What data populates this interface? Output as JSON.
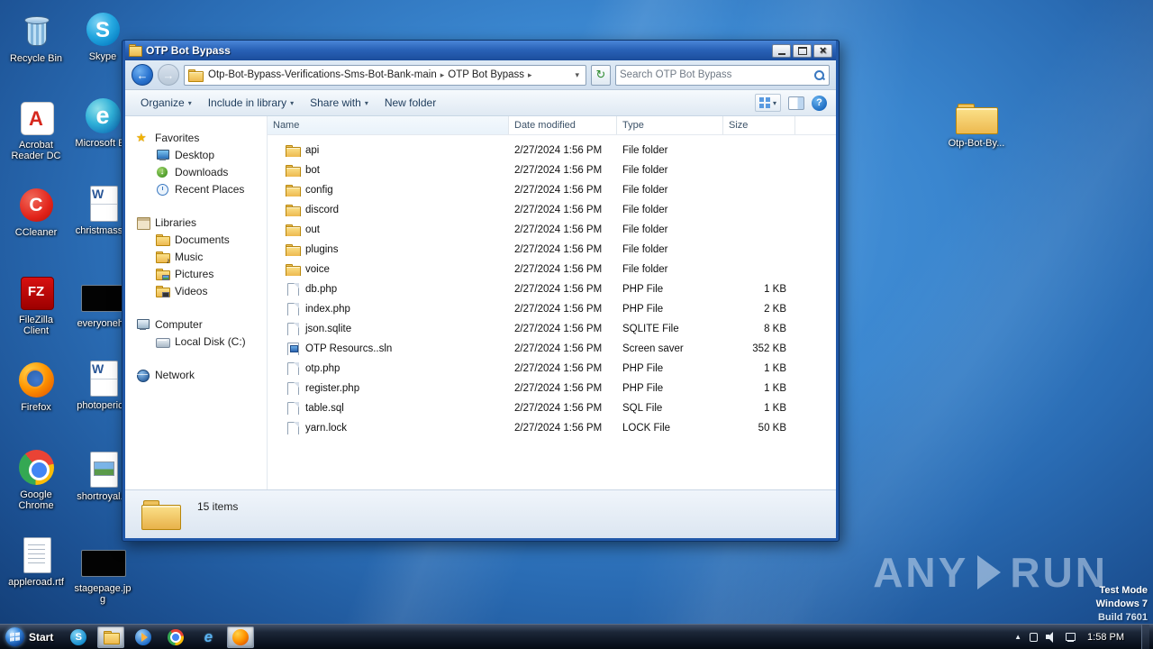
{
  "desktop": {
    "left_icons": [
      {
        "label": "Recycle Bin",
        "kind": "recycle"
      },
      {
        "label": "Skype",
        "kind": "skype"
      },
      {
        "label": "Acrobat Reader DC",
        "kind": "acrobat"
      },
      {
        "label": "Microsoft Ed",
        "kind": "edge"
      },
      {
        "label": "CCleaner",
        "kind": "ccleaner"
      },
      {
        "label": "christmassci",
        "kind": "worddoc"
      },
      {
        "label": "FileZilla Client",
        "kind": "filezilla"
      },
      {
        "label": "everyonehc",
        "kind": "blackimg"
      },
      {
        "label": "Firefox",
        "kind": "firefox"
      },
      {
        "label": "photoperioc",
        "kind": "worddoc"
      },
      {
        "label": "Google Chrome",
        "kind": "chrome"
      },
      {
        "label": "shortroyal.p",
        "kind": "imgfile"
      },
      {
        "label": "appleroad.rtf",
        "kind": "rtf"
      },
      {
        "label": "stagepage.jpg",
        "kind": "blackimg"
      }
    ],
    "right_icon": {
      "label": "Otp-Bot-By...",
      "kind": "folder"
    }
  },
  "window": {
    "title": "OTP Bot Bypass",
    "address": {
      "crumb1": "Otp-Bot-Bypass-Verifications-Sms-Bot-Bank-main",
      "crumb2": "OTP Bot Bypass"
    },
    "search_placeholder": "Search OTP Bot Bypass",
    "toolbar": {
      "organize": "Organize",
      "include": "Include in library",
      "share": "Share with",
      "newfolder": "New folder"
    },
    "sidebar": {
      "favorites": "Favorites",
      "fav_items": [
        "Desktop",
        "Downloads",
        "Recent Places"
      ],
      "libraries": "Libraries",
      "lib_items": [
        "Documents",
        "Music",
        "Pictures",
        "Videos"
      ],
      "computer": "Computer",
      "comp_items": [
        "Local Disk (C:)"
      ],
      "network": "Network"
    },
    "columns": {
      "name": "Name",
      "date": "Date modified",
      "type": "Type",
      "size": "Size"
    },
    "files": [
      {
        "name": "api",
        "date": "2/27/2024 1:56 PM",
        "type": "File folder",
        "size": "",
        "kind": "folder"
      },
      {
        "name": "bot",
        "date": "2/27/2024 1:56 PM",
        "type": "File folder",
        "size": "",
        "kind": "folder"
      },
      {
        "name": "config",
        "date": "2/27/2024 1:56 PM",
        "type": "File folder",
        "size": "",
        "kind": "folder"
      },
      {
        "name": "discord",
        "date": "2/27/2024 1:56 PM",
        "type": "File folder",
        "size": "",
        "kind": "folder"
      },
      {
        "name": "out",
        "date": "2/27/2024 1:56 PM",
        "type": "File folder",
        "size": "",
        "kind": "folder"
      },
      {
        "name": "plugins",
        "date": "2/27/2024 1:56 PM",
        "type": "File folder",
        "size": "",
        "kind": "folder"
      },
      {
        "name": "voice",
        "date": "2/27/2024 1:56 PM",
        "type": "File folder",
        "size": "",
        "kind": "folder"
      },
      {
        "name": "db.php",
        "date": "2/27/2024 1:56 PM",
        "type": "PHP File",
        "size": "1 KB",
        "kind": "file"
      },
      {
        "name": "index.php",
        "date": "2/27/2024 1:56 PM",
        "type": "PHP File",
        "size": "2 KB",
        "kind": "file"
      },
      {
        "name": "json.sqlite",
        "date": "2/27/2024 1:56 PM",
        "type": "SQLITE File",
        "size": "8 KB",
        "kind": "file"
      },
      {
        "name": "OTP Resourcs..sln",
        "date": "2/27/2024 1:56 PM",
        "type": "Screen saver",
        "size": "352 KB",
        "kind": "sln"
      },
      {
        "name": "otp.php",
        "date": "2/27/2024 1:56 PM",
        "type": "PHP File",
        "size": "1 KB",
        "kind": "file"
      },
      {
        "name": "register.php",
        "date": "2/27/2024 1:56 PM",
        "type": "PHP File",
        "size": "1 KB",
        "kind": "file"
      },
      {
        "name": "table.sql",
        "date": "2/27/2024 1:56 PM",
        "type": "SQL File",
        "size": "1 KB",
        "kind": "file"
      },
      {
        "name": "yarn.lock",
        "date": "2/27/2024 1:56 PM",
        "type": "LOCK File",
        "size": "50 KB",
        "kind": "file"
      }
    ],
    "status": "15 items"
  },
  "watermark": {
    "brand_left": "ANY",
    "brand_right": "RUN",
    "line1": "Test Mode",
    "line2": "Windows 7",
    "line3": "Build 7601"
  },
  "taskbar": {
    "start_label": "Start",
    "time": "1:58 PM"
  }
}
